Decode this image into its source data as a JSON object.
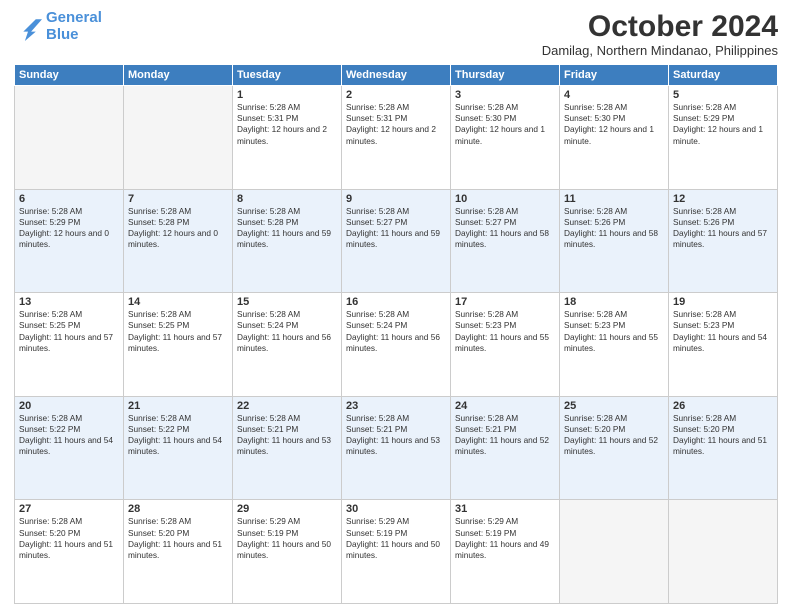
{
  "logo": {
    "line1": "General",
    "line2": "Blue"
  },
  "title": "October 2024",
  "location": "Damilag, Northern Mindanao, Philippines",
  "days_of_week": [
    "Sunday",
    "Monday",
    "Tuesday",
    "Wednesday",
    "Thursday",
    "Friday",
    "Saturday"
  ],
  "weeks": [
    [
      {
        "day": "",
        "empty": true
      },
      {
        "day": "",
        "empty": true
      },
      {
        "day": "1",
        "sunrise": "5:28 AM",
        "sunset": "5:31 PM",
        "daylight": "12 hours and 2 minutes."
      },
      {
        "day": "2",
        "sunrise": "5:28 AM",
        "sunset": "5:31 PM",
        "daylight": "12 hours and 2 minutes."
      },
      {
        "day": "3",
        "sunrise": "5:28 AM",
        "sunset": "5:30 PM",
        "daylight": "12 hours and 1 minute."
      },
      {
        "day": "4",
        "sunrise": "5:28 AM",
        "sunset": "5:30 PM",
        "daylight": "12 hours and 1 minute."
      },
      {
        "day": "5",
        "sunrise": "5:28 AM",
        "sunset": "5:29 PM",
        "daylight": "12 hours and 1 minute."
      }
    ],
    [
      {
        "day": "6",
        "sunrise": "5:28 AM",
        "sunset": "5:29 PM",
        "daylight": "12 hours and 0 minutes."
      },
      {
        "day": "7",
        "sunrise": "5:28 AM",
        "sunset": "5:28 PM",
        "daylight": "12 hours and 0 minutes."
      },
      {
        "day": "8",
        "sunrise": "5:28 AM",
        "sunset": "5:28 PM",
        "daylight": "11 hours and 59 minutes."
      },
      {
        "day": "9",
        "sunrise": "5:28 AM",
        "sunset": "5:27 PM",
        "daylight": "11 hours and 59 minutes."
      },
      {
        "day": "10",
        "sunrise": "5:28 AM",
        "sunset": "5:27 PM",
        "daylight": "11 hours and 58 minutes."
      },
      {
        "day": "11",
        "sunrise": "5:28 AM",
        "sunset": "5:26 PM",
        "daylight": "11 hours and 58 minutes."
      },
      {
        "day": "12",
        "sunrise": "5:28 AM",
        "sunset": "5:26 PM",
        "daylight": "11 hours and 57 minutes."
      }
    ],
    [
      {
        "day": "13",
        "sunrise": "5:28 AM",
        "sunset": "5:25 PM",
        "daylight": "11 hours and 57 minutes."
      },
      {
        "day": "14",
        "sunrise": "5:28 AM",
        "sunset": "5:25 PM",
        "daylight": "11 hours and 57 minutes."
      },
      {
        "day": "15",
        "sunrise": "5:28 AM",
        "sunset": "5:24 PM",
        "daylight": "11 hours and 56 minutes."
      },
      {
        "day": "16",
        "sunrise": "5:28 AM",
        "sunset": "5:24 PM",
        "daylight": "11 hours and 56 minutes."
      },
      {
        "day": "17",
        "sunrise": "5:28 AM",
        "sunset": "5:23 PM",
        "daylight": "11 hours and 55 minutes."
      },
      {
        "day": "18",
        "sunrise": "5:28 AM",
        "sunset": "5:23 PM",
        "daylight": "11 hours and 55 minutes."
      },
      {
        "day": "19",
        "sunrise": "5:28 AM",
        "sunset": "5:23 PM",
        "daylight": "11 hours and 54 minutes."
      }
    ],
    [
      {
        "day": "20",
        "sunrise": "5:28 AM",
        "sunset": "5:22 PM",
        "daylight": "11 hours and 54 minutes."
      },
      {
        "day": "21",
        "sunrise": "5:28 AM",
        "sunset": "5:22 PM",
        "daylight": "11 hours and 54 minutes."
      },
      {
        "day": "22",
        "sunrise": "5:28 AM",
        "sunset": "5:21 PM",
        "daylight": "11 hours and 53 minutes."
      },
      {
        "day": "23",
        "sunrise": "5:28 AM",
        "sunset": "5:21 PM",
        "daylight": "11 hours and 53 minutes."
      },
      {
        "day": "24",
        "sunrise": "5:28 AM",
        "sunset": "5:21 PM",
        "daylight": "11 hours and 52 minutes."
      },
      {
        "day": "25",
        "sunrise": "5:28 AM",
        "sunset": "5:20 PM",
        "daylight": "11 hours and 52 minutes."
      },
      {
        "day": "26",
        "sunrise": "5:28 AM",
        "sunset": "5:20 PM",
        "daylight": "11 hours and 51 minutes."
      }
    ],
    [
      {
        "day": "27",
        "sunrise": "5:28 AM",
        "sunset": "5:20 PM",
        "daylight": "11 hours and 51 minutes."
      },
      {
        "day": "28",
        "sunrise": "5:28 AM",
        "sunset": "5:20 PM",
        "daylight": "11 hours and 51 minutes."
      },
      {
        "day": "29",
        "sunrise": "5:29 AM",
        "sunset": "5:19 PM",
        "daylight": "11 hours and 50 minutes."
      },
      {
        "day": "30",
        "sunrise": "5:29 AM",
        "sunset": "5:19 PM",
        "daylight": "11 hours and 50 minutes."
      },
      {
        "day": "31",
        "sunrise": "5:29 AM",
        "sunset": "5:19 PM",
        "daylight": "11 hours and 49 minutes."
      },
      {
        "day": "",
        "empty": true
      },
      {
        "day": "",
        "empty": true
      }
    ]
  ],
  "labels": {
    "sunrise": "Sunrise:",
    "sunset": "Sunset:",
    "daylight": "Daylight:"
  }
}
